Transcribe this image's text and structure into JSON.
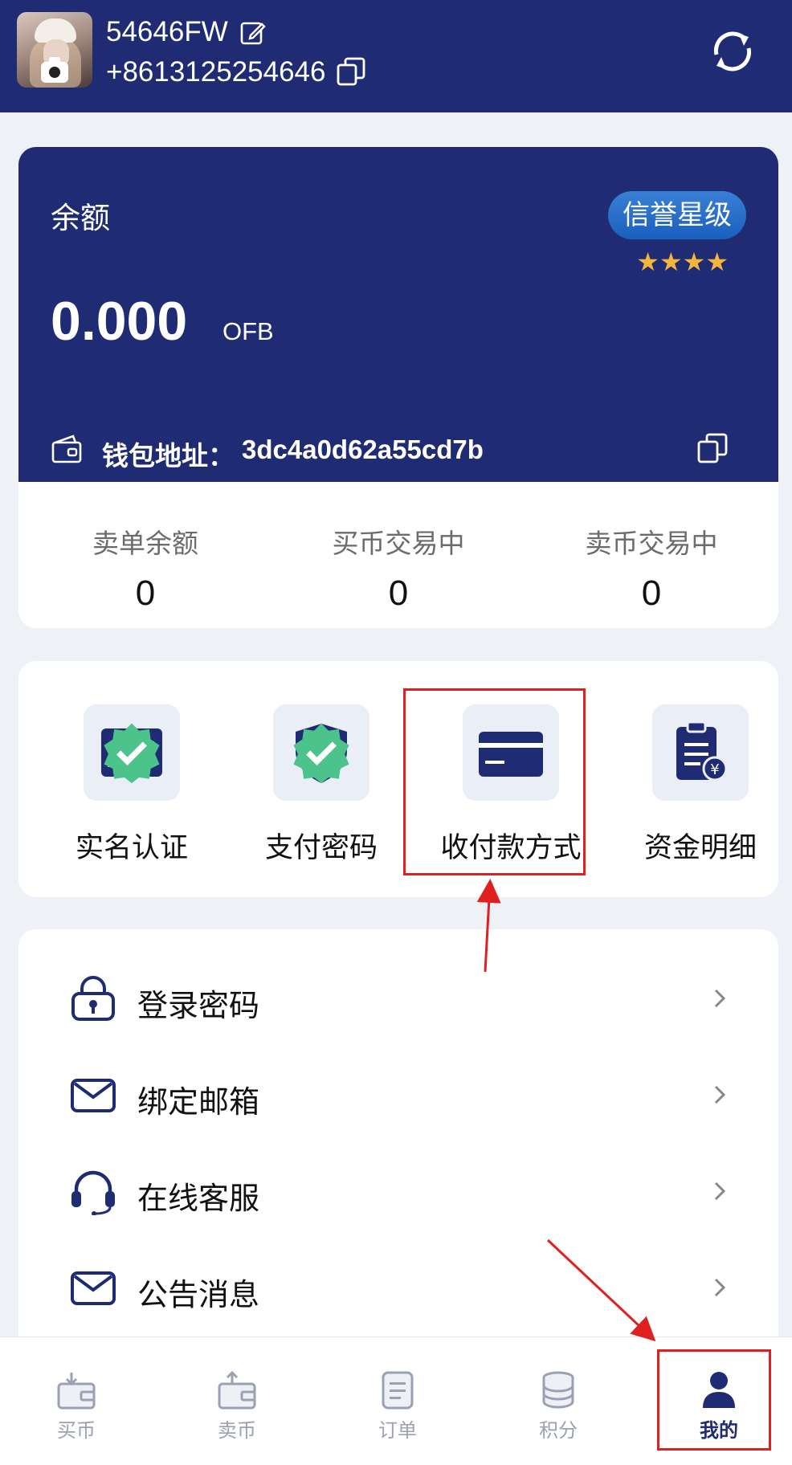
{
  "header": {
    "username": "54646FW",
    "phone": "+8613125254646"
  },
  "balance_card": {
    "label": "余额",
    "credit_badge": "信誉星级",
    "stars": "★★★★",
    "amount": "0.000",
    "unit": "OFB",
    "wallet_label": "钱包地址：",
    "wallet_address": "3dc4a0d62a55cd7b"
  },
  "stats": [
    {
      "label": "卖单余额",
      "value": "0"
    },
    {
      "label": "买币交易中",
      "value": "0"
    },
    {
      "label": "卖币交易中",
      "value": "0"
    }
  ],
  "quick_actions": [
    {
      "label": "实名认证",
      "icon": "id-card-icon",
      "verified": true
    },
    {
      "label": "支付密码",
      "icon": "shield-keyhole-icon",
      "verified": true
    },
    {
      "label": "收付款方式",
      "icon": "bank-card-icon",
      "verified": false
    },
    {
      "label": "资金明细",
      "icon": "clipboard-yuan-icon",
      "verified": false
    }
  ],
  "menu": [
    {
      "label": "登录密码",
      "icon": "lock-icon"
    },
    {
      "label": "绑定邮箱",
      "icon": "mail-icon"
    },
    {
      "label": "在线客服",
      "icon": "headset-icon"
    },
    {
      "label": "公告消息",
      "icon": "mail-icon"
    }
  ],
  "tabs": [
    {
      "label": "买币",
      "icon": "buy-wallet-icon"
    },
    {
      "label": "卖币",
      "icon": "sell-wallet-icon"
    },
    {
      "label": "订单",
      "icon": "order-list-icon"
    },
    {
      "label": "积分",
      "icon": "coins-stack-icon"
    },
    {
      "label": "我的",
      "icon": "user-icon",
      "active": true
    }
  ],
  "colors": {
    "primary": "#1f2b73",
    "badge": "#2a6fcc",
    "star": "#f4b63a",
    "verified": "#4cc38a",
    "annotation": "#e02020"
  }
}
